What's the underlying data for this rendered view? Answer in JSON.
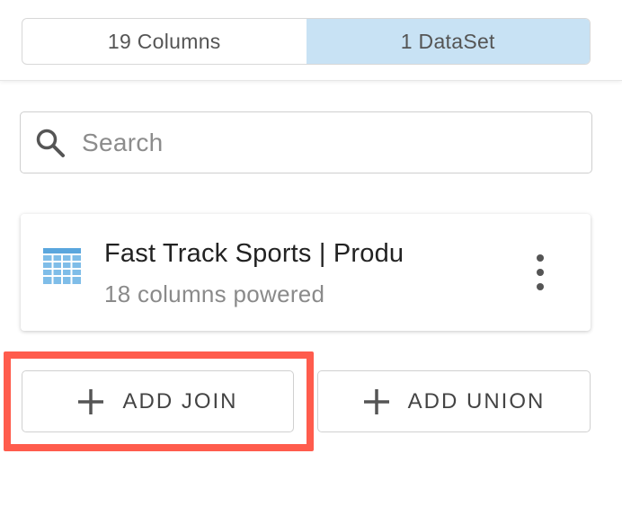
{
  "toggle": {
    "options": [
      {
        "label": "19 Columns",
        "active": false
      },
      {
        "label": "1 DataSet",
        "active": true
      }
    ]
  },
  "search": {
    "placeholder": "Search",
    "value": "",
    "icon": "search-icon"
  },
  "dataset_card": {
    "title": "Fast Track Sports | Produ",
    "subtitle": "18 columns powered",
    "icon": "table-icon",
    "menu_icon": "more-vertical-icon"
  },
  "actions": {
    "add_join_label": "ADD JOIN",
    "add_union_label": "ADD UNION",
    "plus_icon": "plus-icon"
  },
  "colors": {
    "active_toggle": "#c8e2f4",
    "highlight": "#ff5c4d",
    "table_icon": "#7fbde8"
  }
}
